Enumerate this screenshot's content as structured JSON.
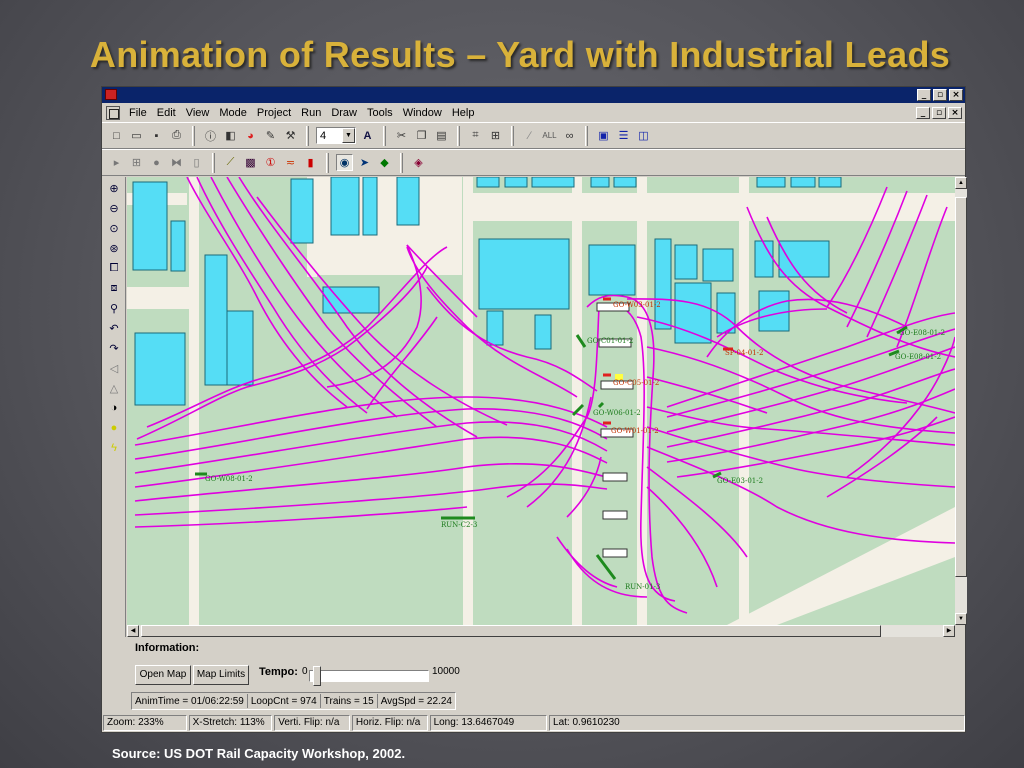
{
  "slide": {
    "title": "Animation of Results – Yard with Industrial Leads",
    "source": "Source: US DOT Rail Capacity Workshop, 2002."
  },
  "window": {
    "menus": [
      "File",
      "Edit",
      "View",
      "Mode",
      "Project",
      "Run",
      "Draw",
      "Tools",
      "Window",
      "Help"
    ],
    "toolbar": {
      "zoom_combo_value": "4"
    }
  },
  "map": {
    "labels": {
      "go_w08": "GO-W08-01-2",
      "go_e08_1": "GO-E08-01-2",
      "go_e08_2": "GO-E08-01-2",
      "go_e03": "GO-E03-01-2",
      "go_w06": "GO-W06-01-2",
      "go_w01": "GO-W01-01-2",
      "go_c05": "GO-C05-01-2",
      "sp_04": "SP-04-01-2",
      "run_c2": "RUN-C2-3",
      "run_01": "RUN-01-3",
      "go_yard_top": "GO-W03-01-2",
      "go_yard_mid": "GO-C01-01-2"
    }
  },
  "info": {
    "label": "Information:",
    "open_map": "Open Map",
    "map_limits": "Map Limits",
    "tempo_label": "Tempo:",
    "tempo_min": "0",
    "tempo_max": "10000",
    "tempo_value": 0.02,
    "anim_time": "AnimTime = 01/06:22:59",
    "loop_cnt": "LoopCnt = 974",
    "trains": "Trains = 15",
    "avg_spd": "AvgSpd = 22.24"
  },
  "status": {
    "zoom": "Zoom: 233%",
    "xstretch": "X-Stretch: 113%",
    "vflip": "Verti. Flip: n/a",
    "hflip": "Horiz. Flip: n/a",
    "long": "Long: 13.6467049",
    "lat": "Lat: 0.9610230"
  },
  "colors": {
    "track": "#e000e0",
    "building": "#55ddf5",
    "ground": "#bfdcbf",
    "road": "#f4f0e6",
    "signal_green": "#1e8a1e",
    "slide_title": "#d9b23a",
    "titlebar": "#0a246a"
  }
}
